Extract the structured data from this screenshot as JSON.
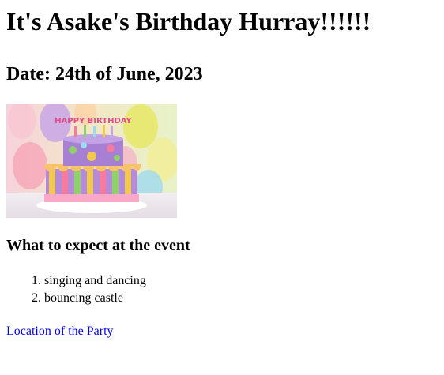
{
  "heading": "It's Asake's Birthday Hurray!!!!!!",
  "date_line": "Date: 24th of June, 2023",
  "image": {
    "alt": "birthday cake",
    "cake_topper_text": "HAPPY BIRTHDAY"
  },
  "expect": {
    "title": "What to expect at the event",
    "items": [
      "singing and dancing",
      "bouncing castle"
    ]
  },
  "location_link": "Location of the Party",
  "colors": {
    "link": "#0000ee",
    "text": "#000000"
  }
}
